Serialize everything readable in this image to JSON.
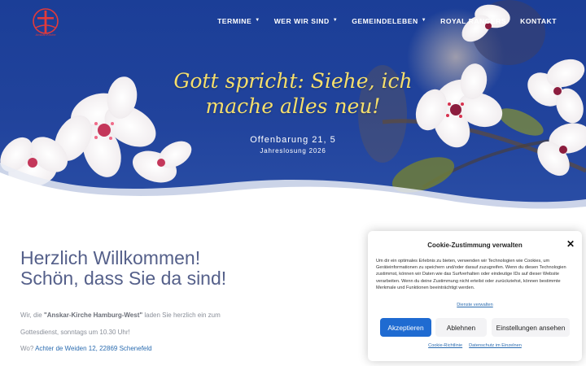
{
  "header": {
    "logo_text": "Anskar-Kirche",
    "nav": [
      {
        "label": "TERMINE",
        "has_dropdown": true
      },
      {
        "label": "WER WIR SIND",
        "has_dropdown": true
      },
      {
        "label": "GEMEINDELEBEN",
        "has_dropdown": true
      },
      {
        "label": "ROYAL RANGERS",
        "has_dropdown": false
      },
      {
        "label": "KONTAKT",
        "has_dropdown": false
      }
    ]
  },
  "hero": {
    "verse_line1": "Gott spricht: Siehe, ich",
    "verse_line2": "mache alles neu!",
    "reference": "Offenbarung 21, 5",
    "subtitle": "Jahreslosung 2026"
  },
  "welcome": {
    "line1": "Herzlich Willkommen!",
    "line2": "Schön, dass Sie da sind!",
    "intro_prefix": "Wir, die ",
    "intro_church": "\"Anskar-Kirche Hamburg-West\"",
    "intro_suffix": " laden Sie herzlich ein zum",
    "service": "Gottesdienst, sonntags um 10.30 Uhr!",
    "address_prefix": "Wo? ",
    "address_link": "Achter de Weiden 12, 22869 Schenefeld"
  },
  "cookie": {
    "title": "Cookie-Zustimmung verwalten",
    "text": "Um dir ein optimales Erlebnis zu bieten, verwenden wir Technologien wie Cookies, um Geräteinformationen zu speichern und/oder darauf zuzugreifen. Wenn du diesen Technologien zustimmst, können wir Daten wie das Surfverhalten oder eindeutige IDs auf dieser Website verarbeiten. Wenn du deine Zustimmung nicht erteilst oder zurückziehst, können bestimmte Merkmale und Funktionen beeinträchtigt werden.",
    "vendors_link": "Dienste verwalten",
    "accept": "Akzeptieren",
    "decline": "Ablehnen",
    "settings": "Einstellungen ansehen",
    "policy_link": "Cookie-Richtlinie",
    "privacy_link": "Datenschutz im Einzelnen"
  },
  "colors": {
    "hero_blue": "#21439c",
    "verse_yellow": "#f6df6c",
    "link_blue": "#2b6cb0",
    "accept_button": "#1f6bd1",
    "logo_red": "#e23a3a"
  },
  "icons": [
    "cross-logo-icon",
    "chevron-down-icon",
    "close-icon"
  ]
}
